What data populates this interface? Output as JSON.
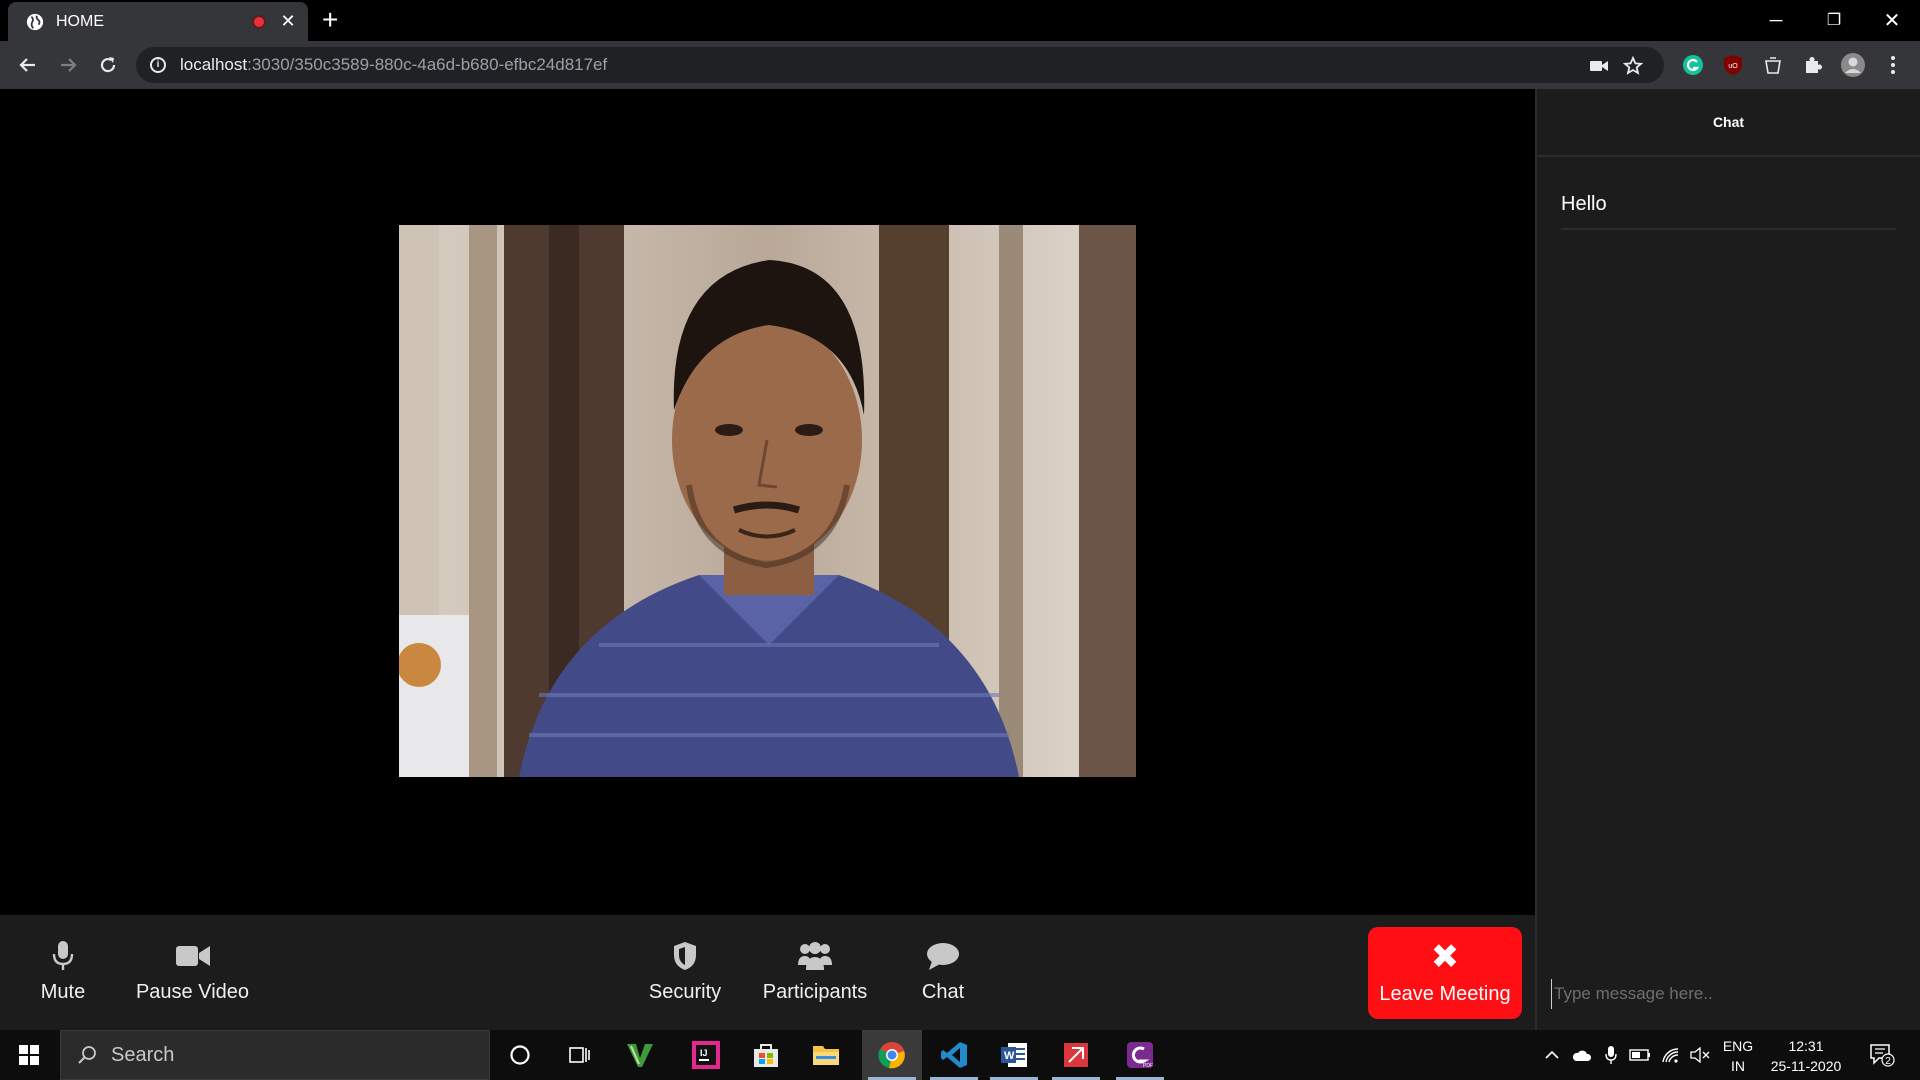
{
  "browser": {
    "tab_title": "HOME",
    "tab_close": "✕",
    "new_tab": "+",
    "url_host": "localhost",
    "url_path": ":3030/350c3589-880c-4a6d-b680-efbc24d817ef",
    "window_minimize": "─",
    "window_restore": "❐",
    "window_close": "✕"
  },
  "controls": {
    "mute": "Mute",
    "pause_video": "Pause Video",
    "security": "Security",
    "participants": "Participants",
    "chat": "Chat",
    "leave": "Leave Meeting",
    "leave_icon": "✖"
  },
  "chat": {
    "title": "Chat",
    "messages": [
      "Hello"
    ],
    "input_placeholder": "Type message here.."
  },
  "taskbar": {
    "search": "Search",
    "lang_top": "ENG",
    "lang_bottom": "IN",
    "time": "12:31",
    "date": "25-11-2020",
    "notification_count": "2"
  },
  "colors": {
    "leave_button": "#ff0f13",
    "controls_bg": "#1c1c1c",
    "chrome_bg": "#35363a"
  }
}
